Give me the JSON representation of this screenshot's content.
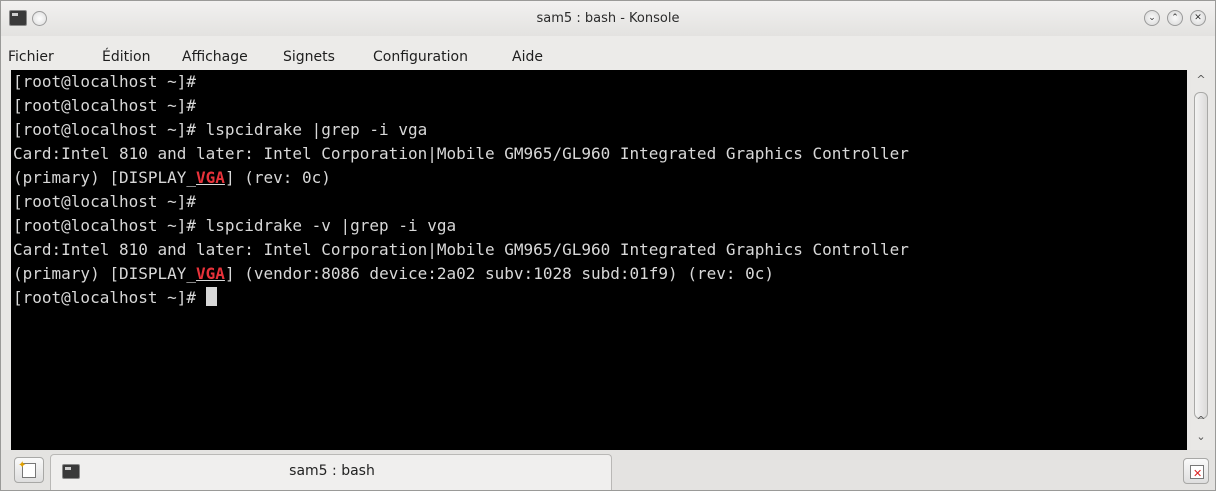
{
  "window": {
    "title": "sam5 : bash - Konsole",
    "buttons": {
      "minimize": "⌄",
      "maximize": "⌃",
      "close": "✕"
    }
  },
  "menu": {
    "items": [
      {
        "label": "Fichier"
      },
      {
        "label": "Édition"
      },
      {
        "label": "Affichage"
      },
      {
        "label": "Signets"
      },
      {
        "label": "Configuration"
      },
      {
        "label": "Aide"
      }
    ]
  },
  "terminal": {
    "background": "#000000",
    "foreground": "#d8d8d8",
    "highlight_color": "#e8323a",
    "lines": [
      {
        "prompt": "[root@localhost ~]# ",
        "text": ""
      },
      {
        "prompt": "[root@localhost ~]# ",
        "text": ""
      },
      {
        "prompt": "[root@localhost ~]# ",
        "text": "lspcidrake |grep -i vga"
      },
      {
        "text": "Card:Intel 810 and later: Intel Corporation|Mobile GM965/GL960 Integrated Graphics Controller"
      },
      {
        "pre": "(primary) [DISPLAY_",
        "match": "VGA",
        "post": "] (rev: 0c)"
      },
      {
        "prompt": "[root@localhost ~]# ",
        "text": ""
      },
      {
        "prompt": "[root@localhost ~]# ",
        "text": "lspcidrake -v |grep -i vga"
      },
      {
        "text": "Card:Intel 810 and later: Intel Corporation|Mobile GM965/GL960 Integrated Graphics Controller"
      },
      {
        "pre": "(primary) [DISPLAY_",
        "match": "VGA",
        "post": "] (vendor:8086 device:2a02 subv:1028 subd:01f9) (rev: 0c)"
      },
      {
        "prompt": "[root@localhost ~]# ",
        "text": ""
      }
    ]
  },
  "scrollbar": {
    "up_arrow": "^",
    "down_arrow": "⌄",
    "up_arrow_2": "^"
  },
  "tabs": [
    {
      "label": "sam5 : bash",
      "active": true
    }
  ]
}
